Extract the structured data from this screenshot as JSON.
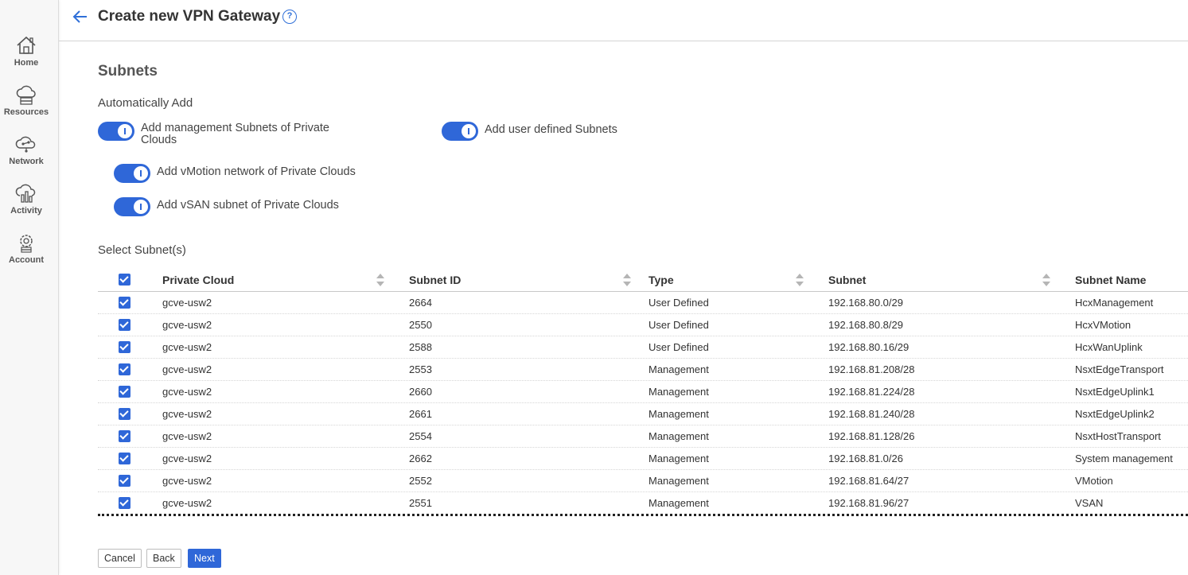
{
  "sidebar": {
    "items": [
      {
        "label": "Home",
        "icon": "home-icon"
      },
      {
        "label": "Resources",
        "icon": "cloud-server-icon"
      },
      {
        "label": "Network",
        "icon": "network-cloud-icon"
      },
      {
        "label": "Activity",
        "icon": "activity-chart-icon"
      },
      {
        "label": "Account",
        "icon": "account-gear-icon"
      }
    ]
  },
  "header": {
    "title": "Create new VPN Gateway",
    "help_symbol": "?"
  },
  "section": {
    "title": "Subnets",
    "auto_add_heading": "Automatically Add",
    "select_heading": "Select Subnet(s)"
  },
  "toggles": {
    "management": {
      "label": "Add management Subnets of Private Clouds",
      "on": true
    },
    "user_defined": {
      "label": "Add user defined Subnets",
      "on": true
    },
    "vmotion": {
      "label": "Add vMotion network of Private Clouds",
      "on": true
    },
    "vsan": {
      "label": "Add vSAN subnet of Private Clouds",
      "on": true
    }
  },
  "table": {
    "columns": [
      "Private Cloud",
      "Subnet ID",
      "Type",
      "Subnet",
      "Subnet Name"
    ],
    "all_selected": true,
    "rows": [
      {
        "cloud": "gcve-usw2",
        "id": "2664",
        "type": "User Defined",
        "subnet": "192.168.80.0/29",
        "name": "HcxManagement",
        "selected": true
      },
      {
        "cloud": "gcve-usw2",
        "id": "2550",
        "type": "User Defined",
        "subnet": "192.168.80.8/29",
        "name": "HcxVMotion",
        "selected": true
      },
      {
        "cloud": "gcve-usw2",
        "id": "2588",
        "type": "User Defined",
        "subnet": "192.168.80.16/29",
        "name": "HcxWanUplink",
        "selected": true
      },
      {
        "cloud": "gcve-usw2",
        "id": "2553",
        "type": "Management",
        "subnet": "192.168.81.208/28",
        "name": "NsxtEdgeTransport",
        "selected": true
      },
      {
        "cloud": "gcve-usw2",
        "id": "2660",
        "type": "Management",
        "subnet": "192.168.81.224/28",
        "name": "NsxtEdgeUplink1",
        "selected": true
      },
      {
        "cloud": "gcve-usw2",
        "id": "2661",
        "type": "Management",
        "subnet": "192.168.81.240/28",
        "name": "NsxtEdgeUplink2",
        "selected": true
      },
      {
        "cloud": "gcve-usw2",
        "id": "2554",
        "type": "Management",
        "subnet": "192.168.81.128/26",
        "name": "NsxtHostTransport",
        "selected": true
      },
      {
        "cloud": "gcve-usw2",
        "id": "2662",
        "type": "Management",
        "subnet": "192.168.81.0/26",
        "name": "System management",
        "selected": true
      },
      {
        "cloud": "gcve-usw2",
        "id": "2552",
        "type": "Management",
        "subnet": "192.168.81.64/27",
        "name": "VMotion",
        "selected": true
      },
      {
        "cloud": "gcve-usw2",
        "id": "2551",
        "type": "Management",
        "subnet": "192.168.81.96/27",
        "name": "VSAN",
        "selected": true
      }
    ]
  },
  "footer": {
    "cancel_label": "Cancel",
    "back_label": "Back",
    "next_label": "Next"
  },
  "colors": {
    "accent": "#2f67d8"
  }
}
